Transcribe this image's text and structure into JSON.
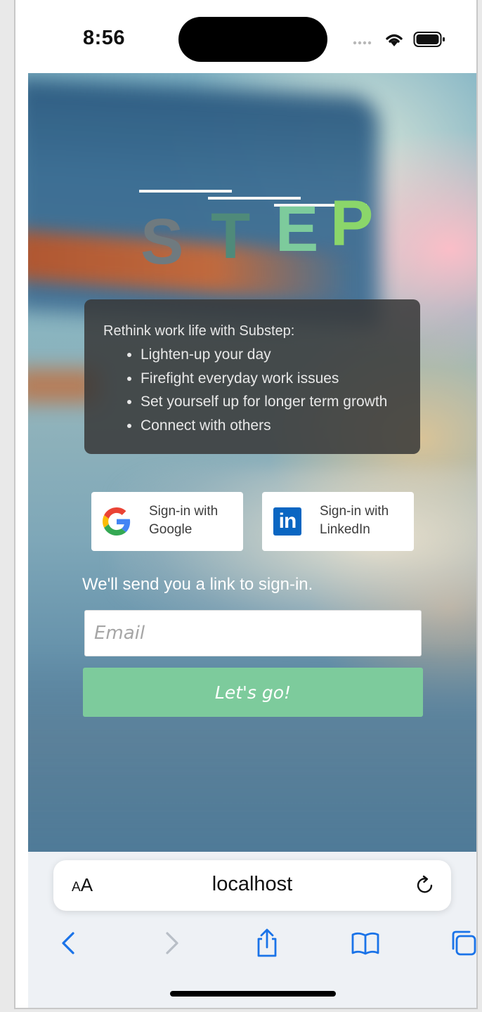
{
  "status_bar": {
    "time": "8:56",
    "icons": [
      "signal-dots-icon",
      "wifi-icon",
      "battery-icon"
    ]
  },
  "logo": {
    "letters": [
      {
        "char": "S",
        "color": "#6f7a7f"
      },
      {
        "char": "T",
        "color": "#4f8a7a"
      },
      {
        "char": "E",
        "color": "#7dcb9c"
      },
      {
        "char": "P",
        "color": "#8bd66a"
      }
    ]
  },
  "info_card": {
    "intro": "Rethink work life with Substep:",
    "items": [
      "Lighten-up your day",
      "Firefight everyday work issues",
      "Set yourself up for longer term growth",
      "Connect with others"
    ]
  },
  "sso": {
    "google": {
      "label_line1": "Sign-in with",
      "label_line2": "Google",
      "icon": "google-icon"
    },
    "linkedin": {
      "label_line1": "Sign-in with",
      "label_line2": "LinkedIn",
      "icon": "linkedin-icon",
      "badge_text": "in"
    }
  },
  "email_form": {
    "message": "We'll send you a link to sign-in.",
    "email_placeholder": "Email",
    "email_value": "",
    "submit_label": "Let's go!"
  },
  "browser": {
    "text_size_label_small": "A",
    "text_size_label_large": "A",
    "url": "localhost",
    "icons": [
      "reload-icon",
      "back-icon",
      "forward-icon",
      "share-icon",
      "bookmarks-icon",
      "tabs-icon"
    ]
  },
  "colors": {
    "accent_green": "#7dcb9c",
    "card_bg": "#373737",
    "linkedin_blue": "#0a66c2",
    "ios_blue": "#1a73e8"
  }
}
